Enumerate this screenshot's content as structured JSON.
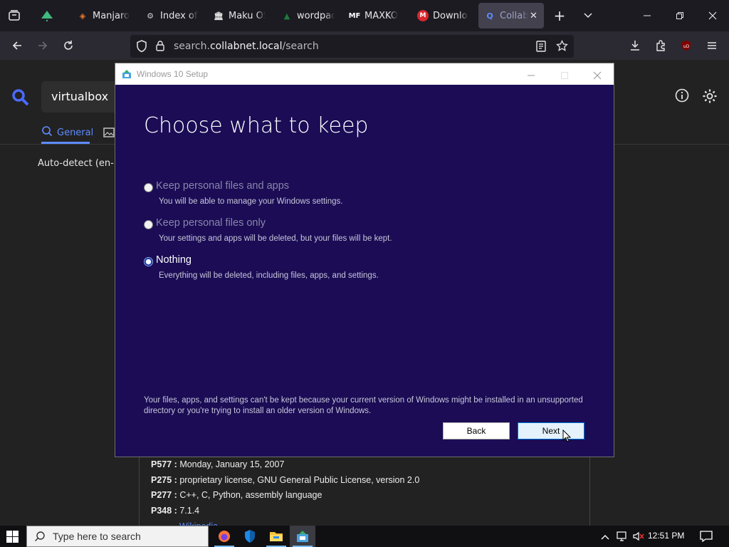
{
  "browser": {
    "tabs": [
      {
        "label": "Manjaro",
        "icon": "manjaro-icon"
      },
      {
        "label": "Index of /",
        "icon": "index-icon"
      },
      {
        "label": "Maku OS",
        "icon": "bank-icon"
      },
      {
        "label": "wordpad",
        "icon": "wordpad-icon"
      },
      {
        "label": "MAXKO",
        "icon": "mf-icon"
      },
      {
        "label": "Download",
        "icon": "mega-icon"
      },
      {
        "label": "Collab",
        "icon": "collabnet-icon"
      }
    ],
    "url_prefix": "search.",
    "url_host": "collabnet.local",
    "url_path": "/search"
  },
  "page": {
    "search_query": "virtualbox",
    "general_tab": "General",
    "autodetect": "Auto-detect (en-US",
    "info": [
      {
        "key": "P577 :",
        "value": " Monday, January 15, 2007"
      },
      {
        "key": "P275 :",
        "value": " proprietary license, GNU General Public License, version 2.0"
      },
      {
        "key": "P277 :",
        "value": " C++, C, Python, assembly language"
      },
      {
        "key": "P348 :",
        "value": " 7.1.4"
      }
    ],
    "wiki_link": "Wikipedia"
  },
  "setup": {
    "title": "Windows 10 Setup",
    "heading": "Choose what to keep",
    "options": [
      {
        "label": "Keep personal files and apps",
        "desc": "You will be able to manage your Windows settings.",
        "enabled": false,
        "selected": false
      },
      {
        "label": "Keep personal files only",
        "desc": "Your settings and apps will be deleted, but your files will be kept.",
        "enabled": false,
        "selected": false
      },
      {
        "label": "Nothing",
        "desc": "Everything will be deleted, including files, apps, and settings.",
        "enabled": true,
        "selected": true
      }
    ],
    "footnote": "Your files, apps, and settings can't be kept because your current version of Windows might be installed in an unsupported directory or you're trying to install an older version of Windows.",
    "back": "Back",
    "next": "Next"
  },
  "taskbar": {
    "search_placeholder": "Type here to search",
    "time": "12:51 PM"
  }
}
